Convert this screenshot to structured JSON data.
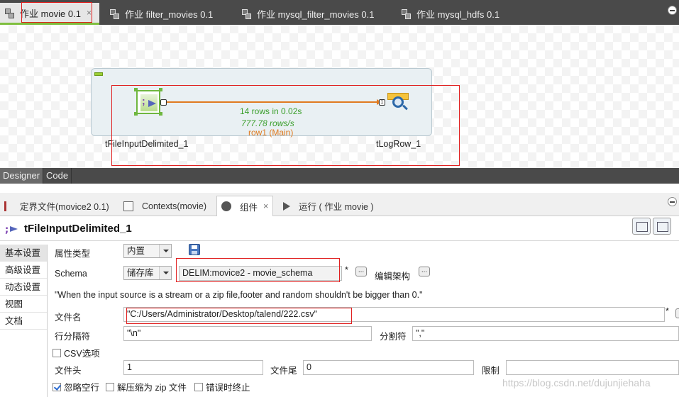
{
  "editor_tabs": [
    {
      "label": "作业 movie 0.1",
      "close": "×"
    },
    {
      "label": "作业 filter_movies 0.1"
    },
    {
      "label": "作业 mysql_filter_movies 0.1"
    },
    {
      "label": "作业 mysql_hdfs 0.1"
    }
  ],
  "canvas": {
    "component1": "tFileInputDelimited_1",
    "component2": "tLogRow_1",
    "stat_rows": "14 rows in 0.02s",
    "stat_rate": "777.78 rows/s",
    "row_label": "row1 (Main)",
    "port_in": "1"
  },
  "colors": {
    "stats_green": "#3a9e2a",
    "row_orange": "#e07a1f",
    "accent_red": "#e02020"
  },
  "view_tabs": {
    "designer": "Designer",
    "code": "Code"
  },
  "props_tabs": [
    {
      "label": "定界文件(movice2 0.1)"
    },
    {
      "label": "Contexts(movie)"
    },
    {
      "label": "组件",
      "close": "×"
    },
    {
      "label": "运行 ( 作业 movie )"
    }
  ],
  "component_title": "tFileInputDelimited_1",
  "side_tabs": [
    "基本设置",
    "高级设置",
    "动态设置",
    "视图",
    "文档"
  ],
  "form": {
    "property_type_label": "属性类型",
    "property_type_value": "内置",
    "schema_label": "Schema",
    "schema_type_value": "储存库",
    "schema_value": "DELIM:movice2 - movie_schema",
    "required_mark": "*",
    "dots": "...",
    "edit_schema_label": "编辑架构",
    "note": "\"When the input source is a stream or a zip file,footer and random shouldn't be bigger than 0.\"",
    "filename_label": "文件名",
    "filename_value": "\"C:/Users/Administrator/Desktop/talend/222.csv\"",
    "row_sep_label": "行分隔符",
    "row_sep_value": "\"\\n\"",
    "field_sep_label": "分割符",
    "field_sep_value": "\",\"",
    "csv_label": "CSV选项",
    "header_label": "文件头",
    "header_value": "1",
    "footer_label": "文件尾",
    "footer_value": "0",
    "limit_label": "限制",
    "limit_value": "",
    "skip_empty_label": "忽略空行",
    "skip_empty_checked": true,
    "unzip_label": "解压缩为 zip 文件",
    "unzip_checked": false,
    "die_on_error_label": "错误时终止",
    "die_on_error_checked": false,
    "csv_checked": false
  },
  "watermark": "https://blog.csdn.net/dujunjiehaha"
}
